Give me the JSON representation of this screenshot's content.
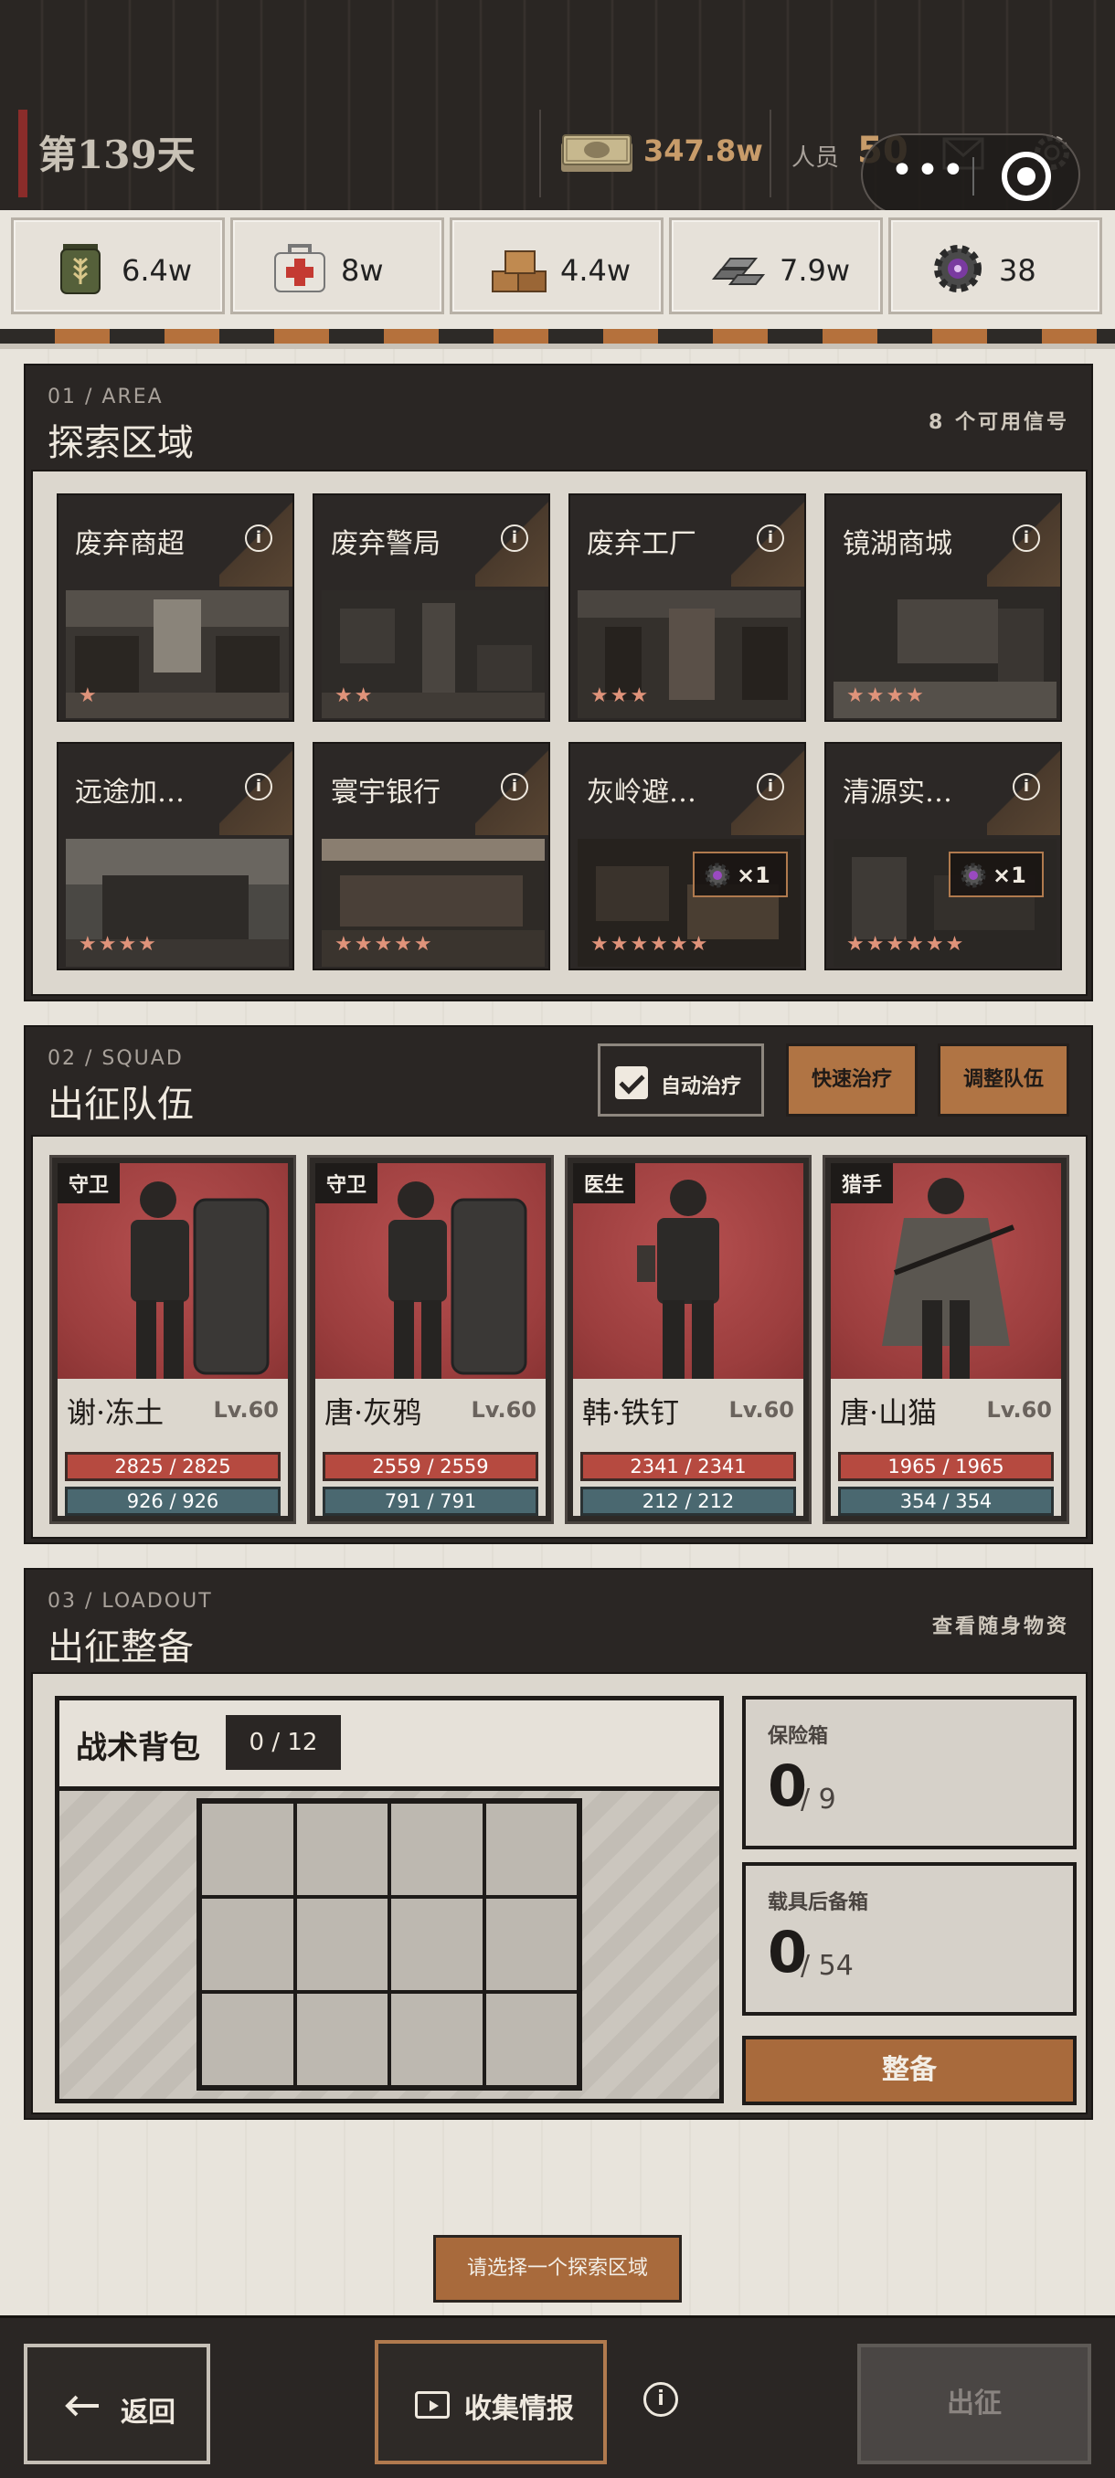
{
  "topbar": {
    "day": "第139天",
    "money": "347.8w",
    "people_label": "人员",
    "people_value": "50"
  },
  "resources": [
    {
      "icon": "grain-sack-icon",
      "value": "6.4w"
    },
    {
      "icon": "medkit-icon",
      "value": "8w"
    },
    {
      "icon": "supply-crates-icon",
      "value": "4.4w"
    },
    {
      "icon": "metal-ingots-icon",
      "value": "7.9w"
    },
    {
      "icon": "gear-chip-icon",
      "value": "38"
    }
  ],
  "area": {
    "num": "01 / AREA",
    "title": "探索区域",
    "signals": "8 个可用信号",
    "cards": [
      {
        "name": "废弃商超",
        "stars": "★",
        "badge": ""
      },
      {
        "name": "废弃警局",
        "stars": "★★",
        "badge": ""
      },
      {
        "name": "废弃工厂",
        "stars": "★★★",
        "badge": ""
      },
      {
        "name": "镜湖商城",
        "stars": "★★★★",
        "badge": ""
      },
      {
        "name": "远途加…",
        "stars": "★★★★",
        "badge": ""
      },
      {
        "name": "寰宇银行",
        "stars": "★★★★★",
        "badge": ""
      },
      {
        "name": "灰岭避…",
        "stars": "★★★★★★",
        "badge": "×1"
      },
      {
        "name": "清源实…",
        "stars": "★★★★★★",
        "badge": "×1"
      }
    ]
  },
  "squad": {
    "num": "02 / SQUAD",
    "title": "出征队伍",
    "auto_heal": "自动治疗",
    "quick_heal": "快速治疗",
    "adjust_team": "调整队伍",
    "members": [
      {
        "role": "守卫",
        "name": "谢·冻土",
        "level": "Lv.60",
        "hp": "2825 / 2825",
        "mp": "926 / 926"
      },
      {
        "role": "守卫",
        "name": "唐·灰鸦",
        "level": "Lv.60",
        "hp": "2559 / 2559",
        "mp": "791 / 791"
      },
      {
        "role": "医生",
        "name": "韩·铁钉",
        "level": "Lv.60",
        "hp": "2341 / 2341",
        "mp": "212 / 212"
      },
      {
        "role": "猎手",
        "name": "唐·山猫",
        "level": "Lv.60",
        "hp": "1965 / 1965",
        "mp": "354 / 354"
      }
    ]
  },
  "loadout": {
    "num": "03 / LOADOUT",
    "title": "出征整备",
    "view_items": "查看随身物资",
    "bag_title": "战术背包",
    "bag_count": "0 / 12",
    "safe_label": "保险箱",
    "safe_value": "0",
    "safe_max": "/ 9",
    "trunk_label": "载具后备箱",
    "trunk_value": "0",
    "trunk_max": "/ 54",
    "equip_button": "整备"
  },
  "hint": "请选择一个探索区域",
  "bottom": {
    "back": "返回",
    "collect": "收集情报",
    "go": "出征"
  },
  "colors": {
    "accent_bronze": "#a86a3c",
    "panel_dark": "#2a2624",
    "hp_red": "#b64a40",
    "mp_teal": "#4a6870",
    "star": "#e0937a"
  }
}
